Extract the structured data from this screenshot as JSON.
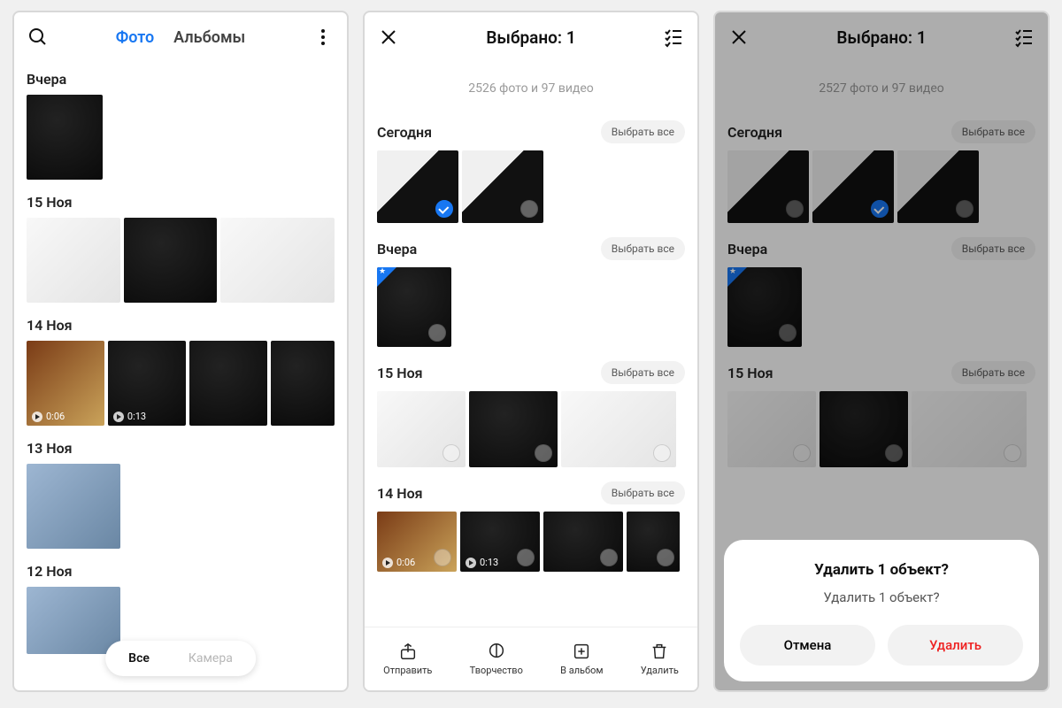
{
  "screen1": {
    "search_icon": "search",
    "tab_photo": "Фото",
    "tab_albums": "Альбомы",
    "sections": {
      "yesterday": "Вчера",
      "nov15": "15 Ноя",
      "nov14": "14 Ноя",
      "nov13": "13 Ноя",
      "nov12": "12 Ноя"
    },
    "videos": {
      "v1": "0:06",
      "v2": "0:13"
    },
    "filter": {
      "all": "Все",
      "camera": "Камера"
    }
  },
  "screen2": {
    "title": "Выбрано: 1",
    "summary": "2526 фото и 97 видео",
    "sections": {
      "today": "Сегодня",
      "yesterday": "Вчера",
      "nov15": "15 Ноя",
      "nov14": "14 Ноя"
    },
    "select_all": "Выбрать все",
    "videos": {
      "v1": "0:06",
      "v2": "0:13"
    },
    "actions": {
      "send": "Отправить",
      "create": "Творчество",
      "album": "В альбом",
      "delete": "Удалить"
    }
  },
  "screen3": {
    "title": "Выбрано: 1",
    "summary": "2527 фото и 97 видео",
    "sections": {
      "today": "Сегодня",
      "yesterday": "Вчера",
      "nov15": "15 Ноя"
    },
    "select_all": "Выбрать все",
    "dialog": {
      "title": "Удалить 1 объект?",
      "message": "Удалить 1 объект?",
      "cancel": "Отмена",
      "confirm": "Удалить"
    }
  }
}
